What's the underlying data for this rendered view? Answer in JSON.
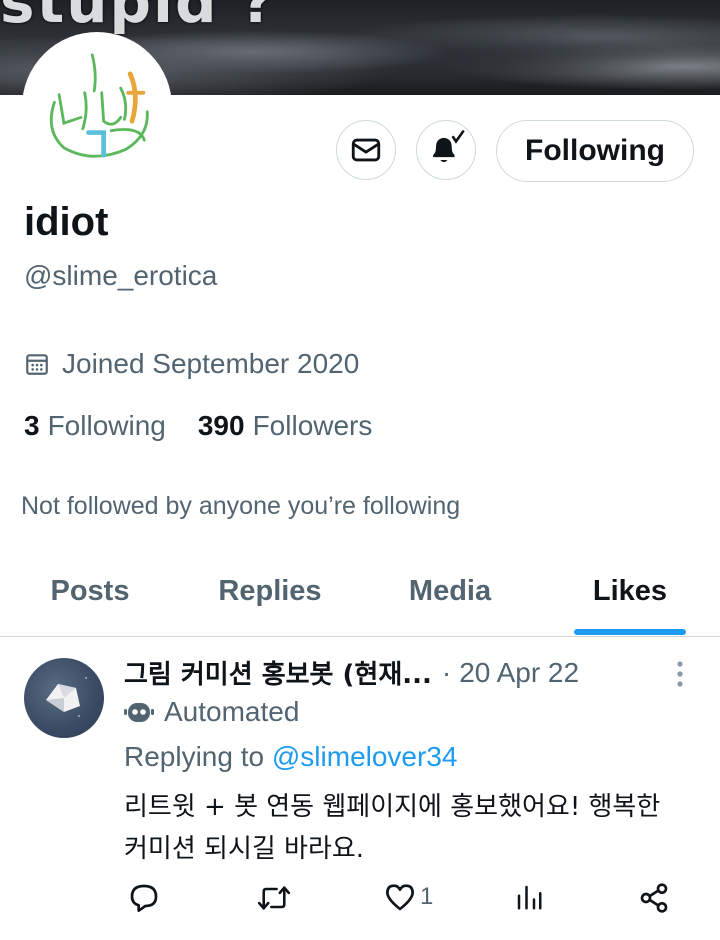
{
  "banner": {
    "text": "stupid ?"
  },
  "profile": {
    "display_name": "idiot",
    "handle": "@slime_erotica",
    "joined": "Joined September 2020",
    "following_count": "3",
    "following_label": "Following",
    "followers_count": "390",
    "followers_label": "Followers",
    "not_followed_text": "Not followed by anyone you’re following"
  },
  "actions": {
    "follow_label": "Following",
    "mail_icon": "mail-icon",
    "bell_icon": "bell-subscribed-icon"
  },
  "tabs": [
    {
      "label": "Posts",
      "active": false
    },
    {
      "label": "Replies",
      "active": false
    },
    {
      "label": "Media",
      "active": false
    },
    {
      "label": "Likes",
      "active": true
    }
  ],
  "tweet": {
    "author_name": "그림 커미션 홍보봇 (현재...",
    "separator": "·",
    "date": "20 Apr 22",
    "automated_label": "Automated",
    "replying_prefix": "Replying to",
    "replying_to": "@slimelover34",
    "body": "리트윗 + 봇 연동 웹페이지에 홍보했어요! 행복한 커미션 되시길 바라요.",
    "like_count": "1"
  },
  "colors": {
    "accent": "#1d9bf0",
    "secondary_text": "#536471",
    "primary_text": "#0f1419",
    "border": "#cfd9de"
  }
}
